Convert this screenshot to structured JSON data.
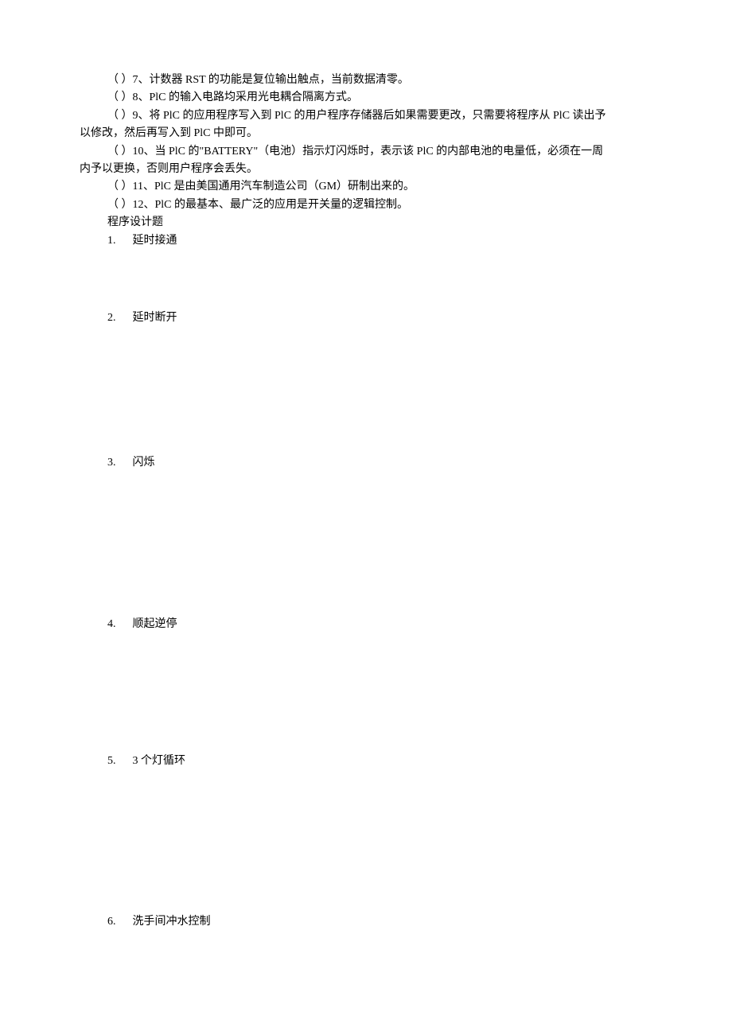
{
  "questions": {
    "q7": "（    ）7、计数器 RST 的功能是复位输出触点，当前数据清零。",
    "q8": "（    ）8、PlC 的输入电路均采用光电耦合隔离方式。",
    "q9_part1": "（    ）9、将 PlC 的应用程序写入到 PlC 的用户程序存储器后如果需要更改，只需要将程序从 PlC 读出予",
    "q9_part2": "以修改，然后再写入到 PlC 中即可。",
    "q10_part1": "（    ）10、当 PlC 的\"BATTERY\"（电池）指示灯闪烁时，表示该 PlC 的内部电池的电量低，必须在一周",
    "q10_part2": "内予以更换，否则用户程序会丢失。",
    "q11": "（    ）11、PlC 是由美国通用汽车制造公司（GM）研制出来的。",
    "q12": "（    ）12、PlC 的最基本、最广泛的应用是开关量的逻辑控制。"
  },
  "section": {
    "title": "程序设计题"
  },
  "prog_items": {
    "p1": {
      "num": "1.",
      "label": "延时接通"
    },
    "p2": {
      "num": "2.",
      "label": "延时断开"
    },
    "p3": {
      "num": "3.",
      "label": "闪烁"
    },
    "p4": {
      "num": "4.",
      "label": "顺起逆停"
    },
    "p5": {
      "num": "5.",
      "label": "3 个灯循环"
    },
    "p6": {
      "num": "6.",
      "label": "洗手间冲水控制"
    }
  }
}
